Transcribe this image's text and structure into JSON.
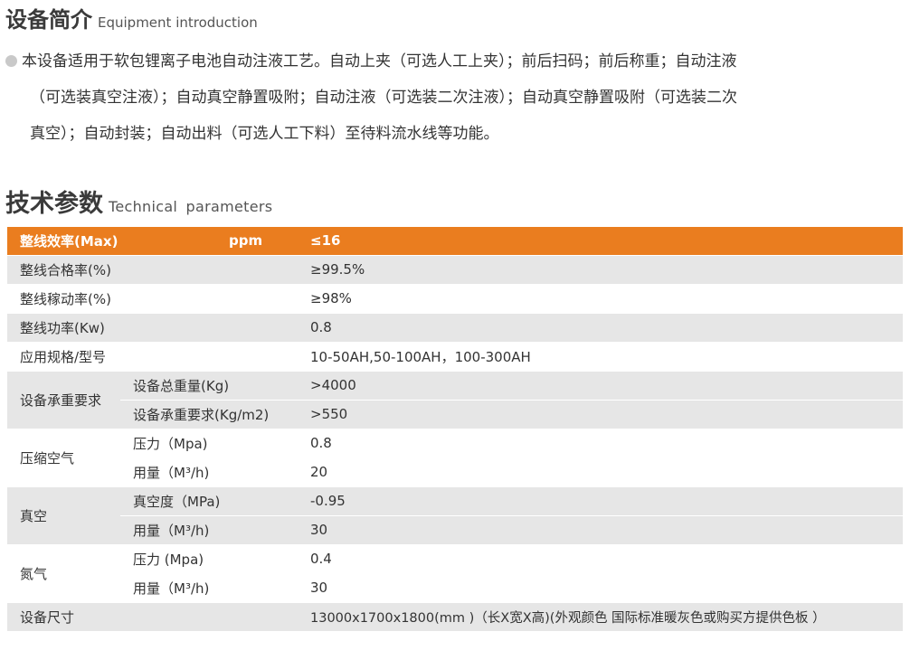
{
  "intro_section": {
    "title_zh": "设备简介",
    "title_en": "Equipment introduction",
    "lines": [
      "本设备适用于软包锂离子电池自动注液工艺。自动上夹（可选人工上夹）；前后扫码；前后称重；自动注液",
      "（可选装真空注液）；自动真空静置吸附；自动注液（可选装二次注液）；自动真空静置吸附（可选装二次",
      "真空）；自动封装；自动出料（可选人工下料）至待料流水线等功能。"
    ]
  },
  "params_section": {
    "title_zh": "技术参数",
    "title_en": "Technical parameters"
  },
  "table": {
    "header": {
      "name": "整线效率(Max)",
      "unit": "ppm",
      "value": "≤16"
    },
    "simple_rows": [
      {
        "name": "整线合格率(%)",
        "value": "≥99.5%"
      },
      {
        "name": "整线稼动率(%)",
        "value": "≥98%"
      },
      {
        "name": "整线功率(Kw)",
        "value": "0.8"
      },
      {
        "name": "应用规格/型号",
        "value": "10-50AH,50-100AH，100-300AH"
      }
    ],
    "groups": [
      {
        "name": "设备承重要求",
        "rows": [
          {
            "sub": "设备总重量(Kg)",
            "value": ">4000"
          },
          {
            "sub": "设备承重要求(Kg/m2)",
            "value": ">550"
          }
        ]
      },
      {
        "name": "压缩空气",
        "rows": [
          {
            "sub": "压力（Mpa)",
            "value": "0.8"
          },
          {
            "sub": "用量（M³/h)",
            "value": "20"
          }
        ]
      },
      {
        "name": "真空",
        "rows": [
          {
            "sub": "真空度（MPa)",
            "value": "-0.95"
          },
          {
            "sub": "用量（M³/h)",
            "value": "30"
          }
        ]
      },
      {
        "name": "氮气",
        "rows": [
          {
            "sub": "压力 (Mpa)",
            "value": "0.4"
          },
          {
            "sub": "用量（M³/h)",
            "value": "30"
          }
        ]
      }
    ],
    "size_row": {
      "name": "设备尺寸",
      "value": "13000x1700x1800(mm )（长X宽X高)(外观颜色 国际标准暖灰色或购买方提供色板 ）"
    }
  },
  "colors": {
    "header_orange": "#ea7d1f",
    "row_gray": "#e6e6e6",
    "bullet_gray": "#c9c9c9"
  }
}
